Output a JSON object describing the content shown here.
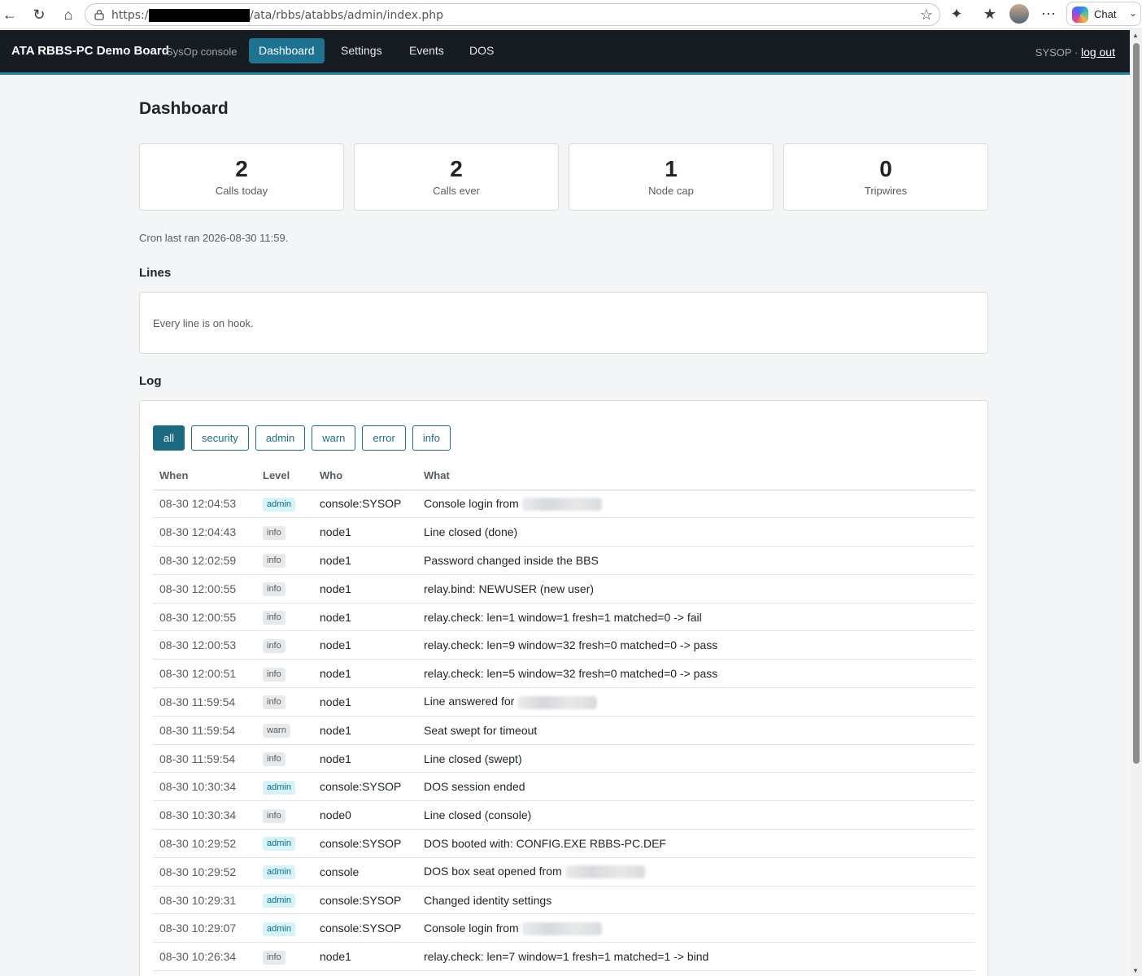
{
  "browser": {
    "url_prefix": "https://",
    "url_path": "/ata/rbbs/atabbs/admin/index.php",
    "chat_label": "Chat"
  },
  "header": {
    "brand": "ATA RBBS-PC Demo Board",
    "brand_sub": "SysOp console",
    "nav": [
      "Dashboard",
      "Settings",
      "Events",
      "DOS"
    ],
    "active_nav": "Dashboard",
    "user": "SYSOP",
    "separator": "·",
    "logout": "log out"
  },
  "page_title": "Dashboard",
  "stats": [
    {
      "value": "2",
      "label": "Calls today"
    },
    {
      "value": "2",
      "label": "Calls ever"
    },
    {
      "value": "1",
      "label": "Node cap"
    },
    {
      "value": "0",
      "label": "Tripwires"
    }
  ],
  "cron_note": "Cron last ran 2026-08-30 11:59.",
  "lines": {
    "heading": "Lines",
    "message": "Every line is on hook."
  },
  "log": {
    "heading": "Log",
    "filters": [
      "all",
      "security",
      "admin",
      "warn",
      "error",
      "info"
    ],
    "active_filter": "all",
    "columns": [
      "When",
      "Level",
      "Who",
      "What"
    ],
    "rows": [
      {
        "when": "08-30 12:04:53",
        "level": "admin",
        "who": "console:SYSOP",
        "what": "Console login from",
        "redacted": true
      },
      {
        "when": "08-30 12:04:43",
        "level": "info",
        "who": "node1",
        "what": "Line closed (done)",
        "redacted": false
      },
      {
        "when": "08-30 12:02:59",
        "level": "info",
        "who": "node1",
        "what": "Password changed inside the BBS",
        "redacted": false
      },
      {
        "when": "08-30 12:00:55",
        "level": "info",
        "who": "node1",
        "what": "relay.bind: NEWUSER (new user)",
        "redacted": false
      },
      {
        "when": "08-30 12:00:55",
        "level": "info",
        "who": "node1",
        "what": "relay.check: len=1 window=1 fresh=1 matched=0 -> fail",
        "redacted": false
      },
      {
        "when": "08-30 12:00:53",
        "level": "info",
        "who": "node1",
        "what": "relay.check: len=9 window=32 fresh=0 matched=0 -> pass",
        "redacted": false
      },
      {
        "when": "08-30 12:00:51",
        "level": "info",
        "who": "node1",
        "what": "relay.check: len=5 window=32 fresh=0 matched=0 -> pass",
        "redacted": false
      },
      {
        "when": "08-30 11:59:54",
        "level": "info",
        "who": "node1",
        "what": "Line answered for",
        "redacted": true
      },
      {
        "when": "08-30 11:59:54",
        "level": "warn",
        "who": "node1",
        "what": "Seat swept for timeout",
        "redacted": false
      },
      {
        "when": "08-30 11:59:54",
        "level": "info",
        "who": "node1",
        "what": "Line closed (swept)",
        "redacted": false
      },
      {
        "when": "08-30 10:30:34",
        "level": "admin",
        "who": "console:SYSOP",
        "what": "DOS session ended",
        "redacted": false
      },
      {
        "when": "08-30 10:30:34",
        "level": "info",
        "who": "node0",
        "what": "Line closed (console)",
        "redacted": false
      },
      {
        "when": "08-30 10:29:52",
        "level": "admin",
        "who": "console:SYSOP",
        "what": "DOS booted with: CONFIG.EXE RBBS-PC.DEF",
        "redacted": false
      },
      {
        "when": "08-30 10:29:52",
        "level": "admin",
        "who": "console",
        "what": "DOS box seat opened from",
        "redacted": true
      },
      {
        "when": "08-30 10:29:31",
        "level": "admin",
        "who": "console:SYSOP",
        "what": "Changed identity settings",
        "redacted": false
      },
      {
        "when": "08-30 10:29:07",
        "level": "admin",
        "who": "console:SYSOP",
        "what": "Console login from",
        "redacted": true
      },
      {
        "when": "08-30 10:26:34",
        "level": "info",
        "who": "node1",
        "what": "relay.check: len=7 window=1 fresh=1 matched=1 -> bind",
        "redacted": false
      }
    ]
  }
}
